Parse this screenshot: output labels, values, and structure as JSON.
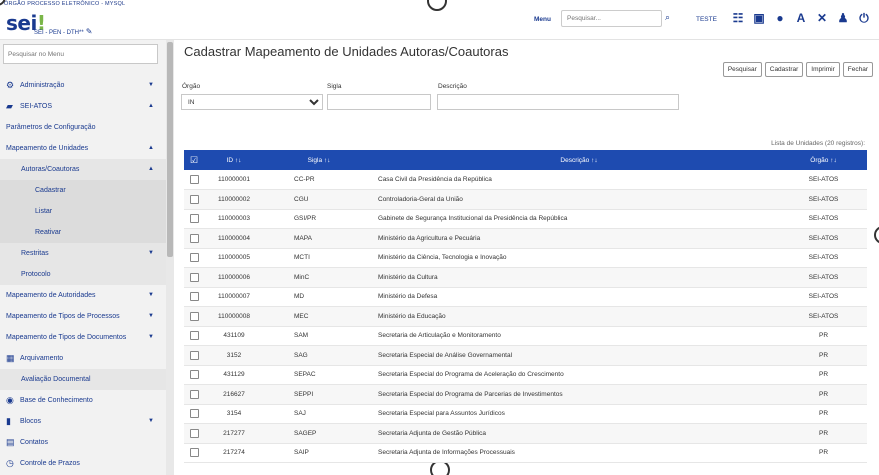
{
  "header": {
    "org_name": "ÓRGÃO PROCESSO ELETRÔNICO - MYSQL",
    "logo_main": "sei",
    "logo_mark": "!",
    "version": "SEI - PEN - DTH**",
    "pencil_icon": "pencil-icon",
    "menu_label": "Menu",
    "search_placeholder": "Pesquisar...",
    "user": "TESTE",
    "icons": [
      "grid-icon",
      "calendar-icon",
      "globe-icon",
      "font-size-icon",
      "tools-icon",
      "user-icon",
      "power-icon"
    ]
  },
  "sidebar": {
    "search_placeholder": "Pesquisar no Menu",
    "items": [
      {
        "label": "Administração",
        "icon": "admin-icon",
        "caret": "▼",
        "level": 0
      },
      {
        "label": "SEI-ATOS",
        "icon": "folder-icon",
        "caret": "▲",
        "level": 0
      },
      {
        "label": "Parâmetros de Configuração",
        "caret": "",
        "level": 1
      },
      {
        "label": "Mapeamento de Unidades",
        "caret": "▲",
        "level": 1
      },
      {
        "label": "Autoras/Coautoras",
        "caret": "▲",
        "level": 2
      },
      {
        "label": "Cadastrar",
        "caret": "",
        "level": 3
      },
      {
        "label": "Listar",
        "caret": "",
        "level": 3
      },
      {
        "label": "Reativar",
        "caret": "",
        "level": 3
      },
      {
        "label": "Restritas",
        "caret": "▼",
        "level": 2
      },
      {
        "label": "Protocolo",
        "caret": "",
        "level": 2
      },
      {
        "label": "Mapeamento de Autoridades",
        "caret": "▼",
        "level": 1
      },
      {
        "label": "Mapeamento de Tipos de Processos",
        "caret": "▼",
        "level": 1
      },
      {
        "label": "Mapeamento de Tipos de Documentos",
        "caret": "▼",
        "level": 1
      },
      {
        "label": "Arquivamento",
        "icon": "archive-icon",
        "caret": "",
        "level": 0
      },
      {
        "label": "Avaliação Documental",
        "caret": "",
        "level": 2
      },
      {
        "label": "Base de Conhecimento",
        "icon": "database-icon",
        "caret": "",
        "level": 0
      },
      {
        "label": "Blocos",
        "icon": "blocks-icon",
        "caret": "▼",
        "level": 0
      },
      {
        "label": "Contatos",
        "icon": "contacts-icon",
        "caret": "",
        "level": 0
      },
      {
        "label": "Controle de Prazos",
        "icon": "clock-icon",
        "caret": "",
        "level": 0
      }
    ]
  },
  "main": {
    "title": "Cadastrar Mapeamento de Unidades Autoras/Coautoras",
    "buttons": [
      "Pesquisar",
      "Cadastrar",
      "Imprimir",
      "Fechar"
    ],
    "filters": {
      "orgao_label": "Órgão",
      "orgao_value": "IN",
      "sigla_label": "Sigla",
      "sigla_value": "",
      "descricao_label": "Descrição",
      "descricao_value": ""
    },
    "caption": "Lista de Unidades (20 registros):",
    "columns": {
      "id": "ID",
      "sigla": "Sigla",
      "descricao": "Descrição",
      "orgao": "Órgão"
    },
    "rows": [
      {
        "id": "110000001",
        "sigla": "CC-PR",
        "descricao": "Casa Civil da Presidência da República",
        "orgao": "SEI-ATOS"
      },
      {
        "id": "110000002",
        "sigla": "CGU",
        "descricao": "Controladoria-Geral da União",
        "orgao": "SEI-ATOS"
      },
      {
        "id": "110000003",
        "sigla": "GSI/PR",
        "descricao": "Gabinete de Segurança Institucional da Presidência da República",
        "orgao": "SEI-ATOS"
      },
      {
        "id": "110000004",
        "sigla": "MAPA",
        "descricao": "Ministério da Agricultura e Pecuária",
        "orgao": "SEI-ATOS"
      },
      {
        "id": "110000005",
        "sigla": "MCTI",
        "descricao": "Ministério da Ciência, Tecnologia e Inovação",
        "orgao": "SEI-ATOS"
      },
      {
        "id": "110000006",
        "sigla": "MinC",
        "descricao": "Ministério da Cultura",
        "orgao": "SEI-ATOS"
      },
      {
        "id": "110000007",
        "sigla": "MD",
        "descricao": "Ministério da Defesa",
        "orgao": "SEI-ATOS"
      },
      {
        "id": "110000008",
        "sigla": "MEC",
        "descricao": "Ministério da Educação",
        "orgao": "SEI-ATOS"
      },
      {
        "id": "431109",
        "sigla": "SAM",
        "descricao": "Secretaria de Articulação e Monitoramento",
        "orgao": "PR"
      },
      {
        "id": "3152",
        "sigla": "SAG",
        "descricao": "Secretaria Especial de Análise Governamental",
        "orgao": "PR"
      },
      {
        "id": "431129",
        "sigla": "SEPAC",
        "descricao": "Secretaria Especial do Programa de Aceleração do Crescimento",
        "orgao": "PR"
      },
      {
        "id": "216627",
        "sigla": "SEPPI",
        "descricao": "Secretaria Especial do Programa de Parcerias de Investimentos",
        "orgao": "PR"
      },
      {
        "id": "3154",
        "sigla": "SAJ",
        "descricao": "Secretaria Especial para Assuntos Jurídicos",
        "orgao": "PR"
      },
      {
        "id": "217277",
        "sigla": "SAGEP",
        "descricao": "Secretaria Adjunta de Gestão Pública",
        "orgao": "PR"
      },
      {
        "id": "217274",
        "sigla": "SAIP",
        "descricao": "Secretaria Adjunta de Informações Processuais",
        "orgao": "PR"
      }
    ]
  }
}
